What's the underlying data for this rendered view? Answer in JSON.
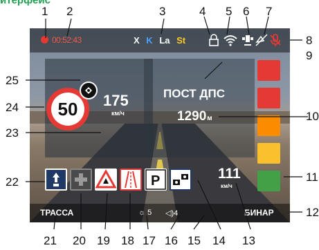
{
  "heading": "итерфейс",
  "status_bar": {
    "rec_time": "00:52:43",
    "bands": [
      "X",
      "K",
      "La",
      "St"
    ]
  },
  "speed_limit": "50",
  "current_speed": {
    "value": "175",
    "unit": "км/ч"
  },
  "alert": {
    "title": "ПОСТ ДПС",
    "distance": "1290",
    "unit": "м"
  },
  "vehicle_speed": {
    "value": "111",
    "unit": "км/ч"
  },
  "bottom_bar": {
    "mode_left": "ТРАССА",
    "mode_right": "БИНАР",
    "brightness": "5",
    "volume": "4"
  },
  "signal_lamps": [
    "#e53935",
    "#e53935",
    "#fb8c00",
    "#fbc02d",
    "#43a047"
  ],
  "callouts": {
    "n1": "1",
    "n2": "2",
    "n3": "3",
    "n4": "4",
    "n5": "5",
    "n6": "6",
    "n7": "7",
    "n8": "8",
    "n9": "9",
    "n10": "10",
    "n11": "11",
    "n12": "12",
    "n13": "13",
    "n14": "14",
    "n15": "15",
    "n16": "16",
    "n17": "17",
    "n18": "18",
    "n19": "19",
    "n20": "20",
    "n21": "21",
    "n22": "22",
    "n23": "23",
    "n24": "24",
    "n25": "25"
  },
  "icons": {
    "lock": "lock-icon",
    "wifi": "wifi-icon",
    "gps": "gps-satellite-icon",
    "mute": "mute-icon",
    "mic": "microphone-off-icon"
  }
}
